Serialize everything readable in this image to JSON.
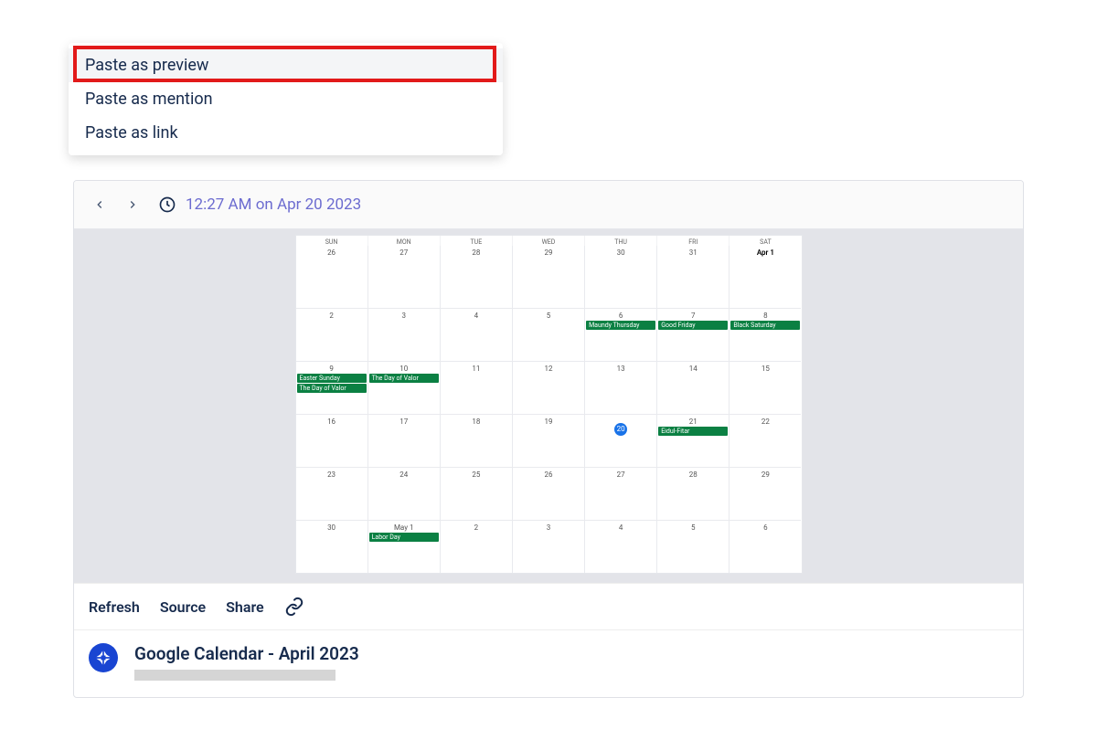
{
  "pasteMenu": {
    "items": [
      {
        "label": "Paste as preview",
        "highlighted": true
      },
      {
        "label": "Paste as mention",
        "highlighted": false
      },
      {
        "label": "Paste as link",
        "highlighted": false
      }
    ]
  },
  "card": {
    "headerTime": "12:27 AM on Apr 20 2023",
    "actions": {
      "refresh": "Refresh",
      "source": "Source",
      "share": "Share"
    },
    "footerTitle": "Google Calendar - April 2023"
  },
  "calendar": {
    "dow": [
      "SUN",
      "MON",
      "TUE",
      "WED",
      "THU",
      "FRI",
      "SAT"
    ],
    "weeks": [
      [
        {
          "n": "26"
        },
        {
          "n": "27"
        },
        {
          "n": "28"
        },
        {
          "n": "29"
        },
        {
          "n": "30"
        },
        {
          "n": "31"
        },
        {
          "n": "Apr 1",
          "bold": true
        }
      ],
      [
        {
          "n": "2"
        },
        {
          "n": "3"
        },
        {
          "n": "4"
        },
        {
          "n": "5"
        },
        {
          "n": "6",
          "events": [
            "Maundy Thursday"
          ]
        },
        {
          "n": "7",
          "events": [
            "Good Friday"
          ]
        },
        {
          "n": "8",
          "events": [
            "Black Saturday"
          ]
        }
      ],
      [
        {
          "n": "9",
          "events": [
            "Easter Sunday",
            "The Day of Valor"
          ]
        },
        {
          "n": "10",
          "events": [
            "The Day of Valor"
          ]
        },
        {
          "n": "11"
        },
        {
          "n": "12"
        },
        {
          "n": "13"
        },
        {
          "n": "14"
        },
        {
          "n": "15"
        }
      ],
      [
        {
          "n": "16"
        },
        {
          "n": "17"
        },
        {
          "n": "18"
        },
        {
          "n": "19"
        },
        {
          "n": "20",
          "today": true
        },
        {
          "n": "21",
          "events": [
            "Eidul-Fitar"
          ]
        },
        {
          "n": "22"
        }
      ],
      [
        {
          "n": "23"
        },
        {
          "n": "24"
        },
        {
          "n": "25"
        },
        {
          "n": "26"
        },
        {
          "n": "27"
        },
        {
          "n": "28"
        },
        {
          "n": "29"
        }
      ],
      [
        {
          "n": "30"
        },
        {
          "n": "May 1",
          "events": [
            "Labor Day"
          ]
        },
        {
          "n": "2"
        },
        {
          "n": "3"
        },
        {
          "n": "4"
        },
        {
          "n": "5"
        },
        {
          "n": "6"
        }
      ]
    ]
  }
}
